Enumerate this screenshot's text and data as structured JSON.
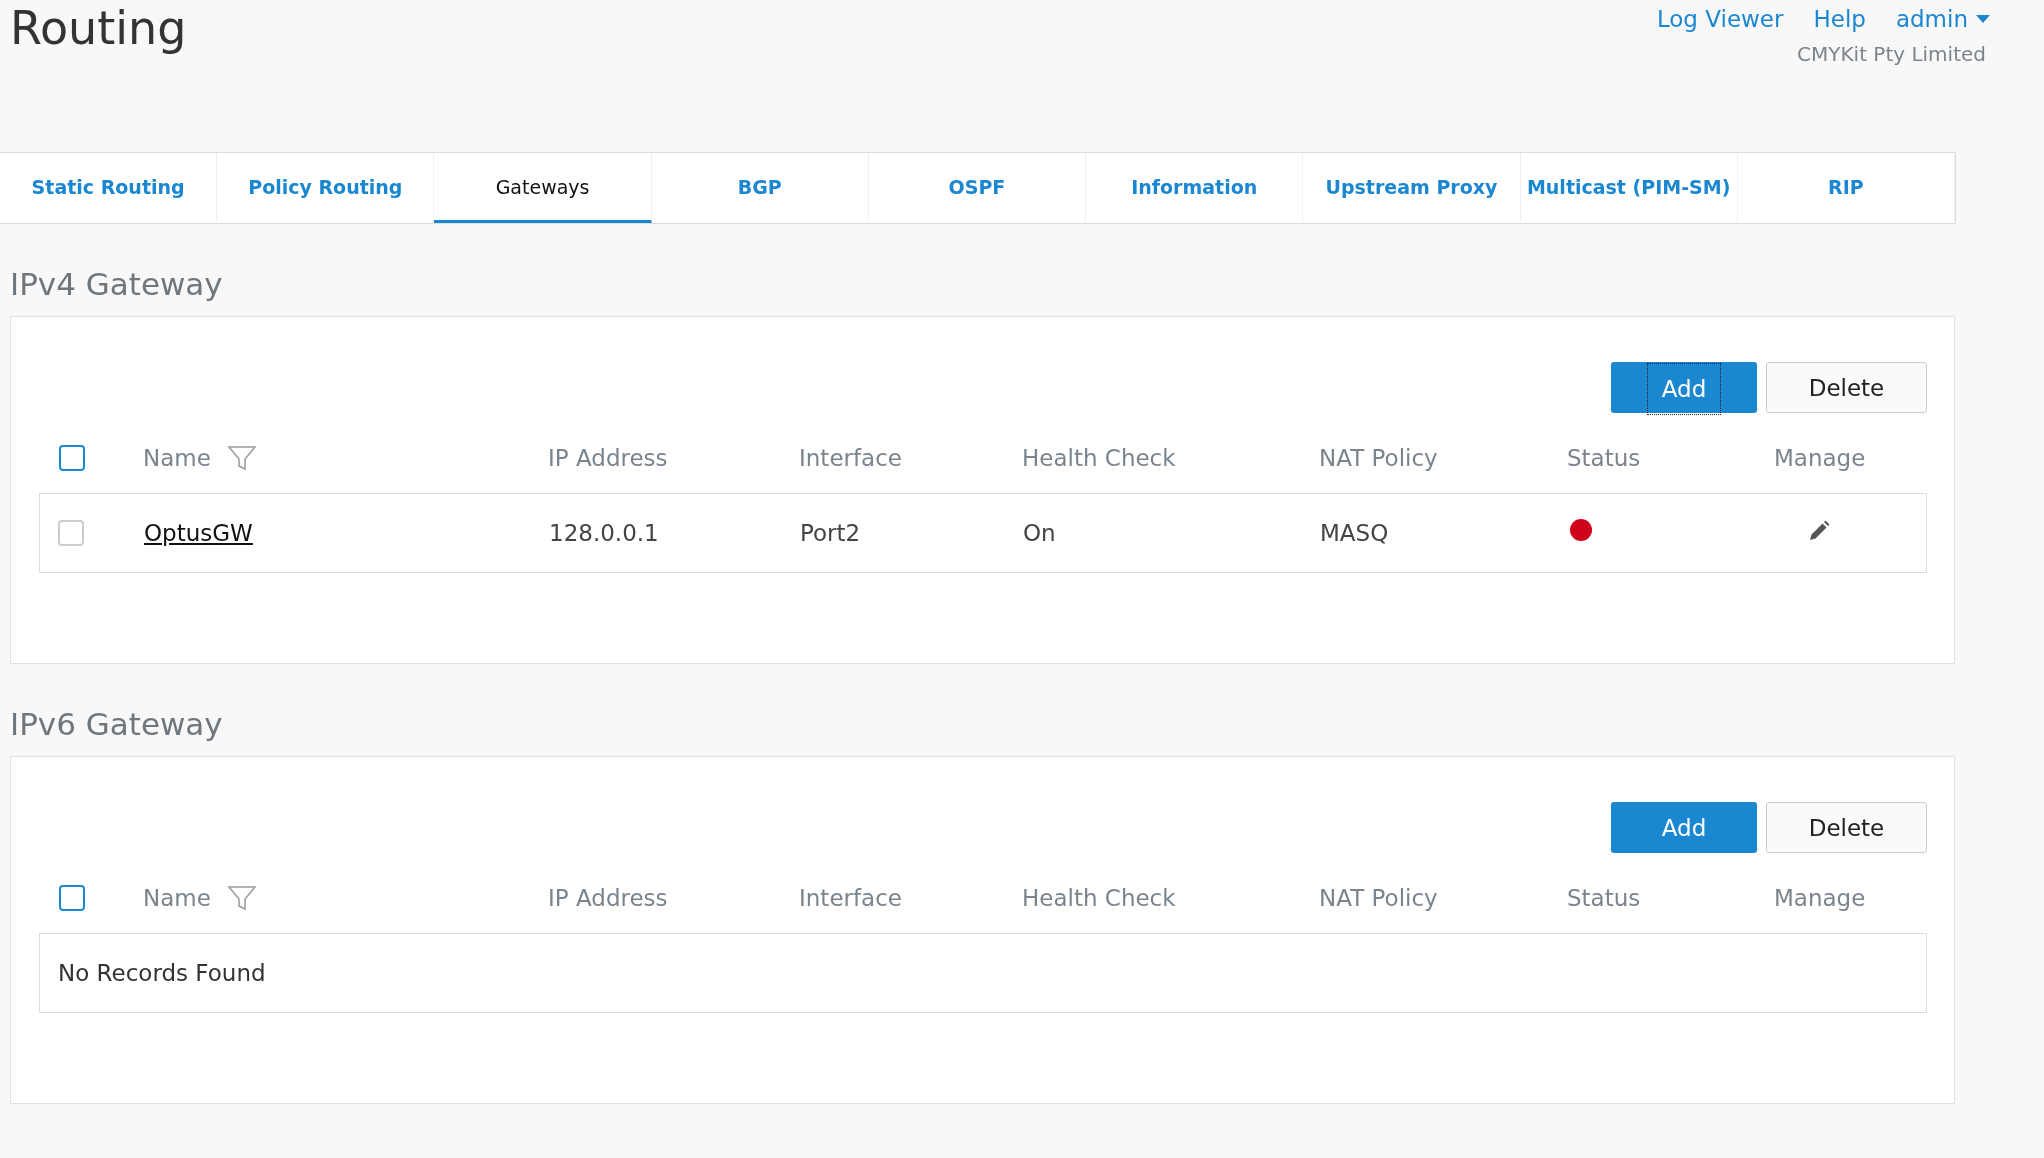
{
  "page_title": "Routing",
  "header_links": [
    {
      "label": "Log Viewer",
      "kind": "link"
    },
    {
      "label": "Help",
      "kind": "link"
    },
    {
      "label": "admin",
      "kind": "menu"
    }
  ],
  "organization": "CMYKit Pty Limited",
  "tabs": [
    {
      "label": "Static Routing",
      "selected": false
    },
    {
      "label": "Policy Routing",
      "selected": false
    },
    {
      "label": "Gateways",
      "selected": true
    },
    {
      "label": "BGP",
      "selected": false
    },
    {
      "label": "OSPF",
      "selected": false
    },
    {
      "label": "Information",
      "selected": false
    },
    {
      "label": "Upstream Proxy",
      "selected": false
    },
    {
      "label": "Multicast (PIM-SM)",
      "selected": false
    },
    {
      "label": "RIP",
      "selected": false
    }
  ],
  "sections": [
    {
      "title": "IPv4 Gateway",
      "buttons": [
        {
          "label": "Add",
          "kind": "primary",
          "focused": true
        },
        {
          "label": "Delete",
          "kind": "secondary",
          "focused": false
        }
      ],
      "select_all": {
        "checked": false
      },
      "columns": [
        "Name",
        "IP Address",
        "Interface",
        "Health Check",
        "NAT Policy",
        "Status",
        "Manage"
      ],
      "rows": [
        {
          "checked": false,
          "name": "OptusGW",
          "ip_address": "128.0.0.1",
          "interface": "Port2",
          "health_check": "On",
          "nat_policy": "MASQ",
          "color": "#d0021b"
        }
      ]
    },
    {
      "title": "IPv6 Gateway",
      "buttons": [
        {
          "label": "Add",
          "kind": "primary",
          "focused": false
        },
        {
          "label": "Delete",
          "kind": "secondary",
          "focused": false
        }
      ],
      "select_all": {
        "checked": false
      },
      "columns": [
        "Name",
        "IP Address",
        "Interface",
        "Health Check",
        "NAT Policy",
        "Status",
        "Manage"
      ],
      "empty_message": "No Records Found"
    }
  ]
}
